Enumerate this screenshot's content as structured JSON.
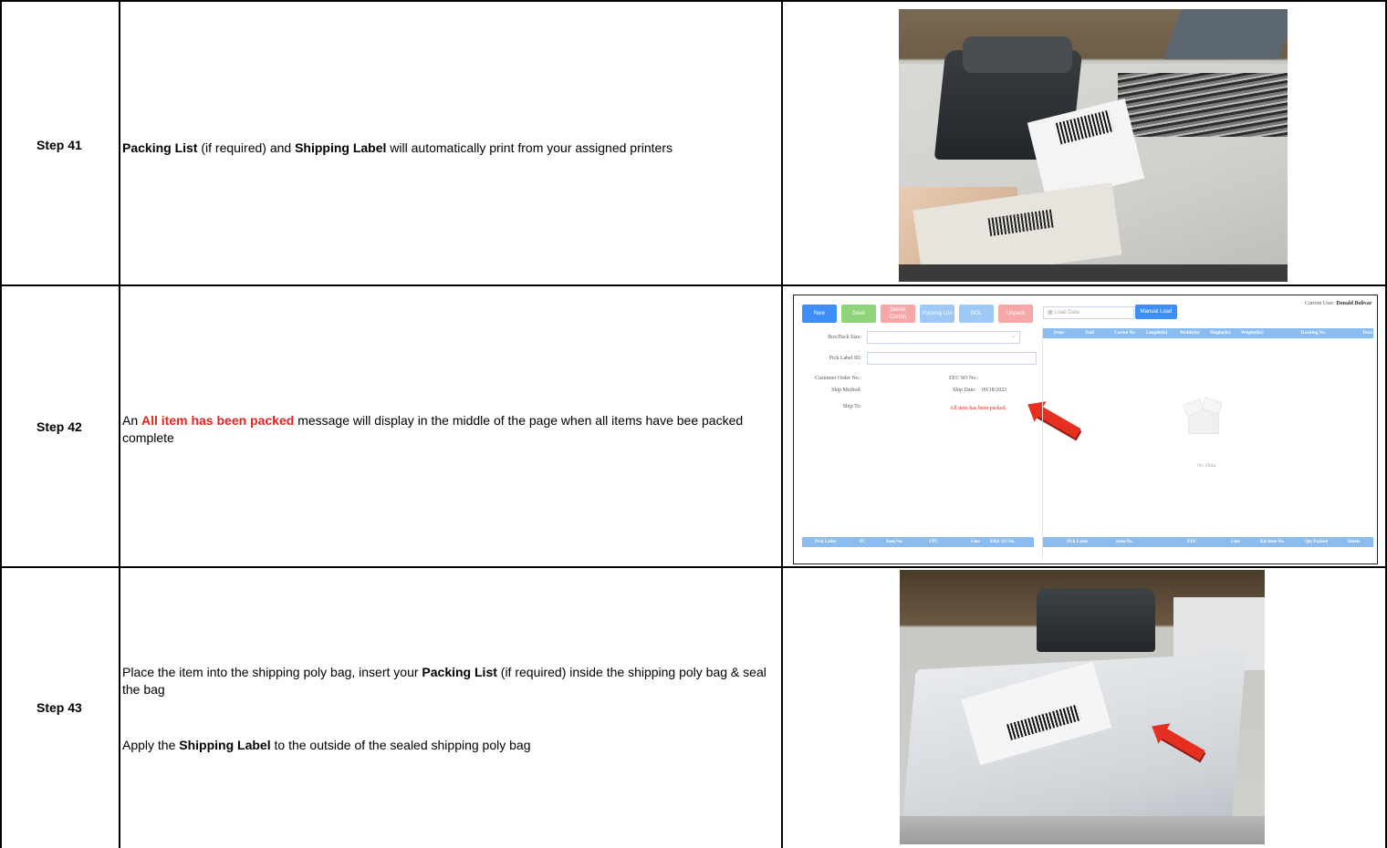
{
  "steps": [
    {
      "label": "Step 41",
      "desc": {
        "b1": "Packing List",
        "t1": " (if required) and ",
        "b2": "Shipping Label",
        "t2": " will automatically print from your assigned printers"
      }
    },
    {
      "label": "Step 42",
      "desc": {
        "t1": "An ",
        "r1": "All item has been packed",
        "t2": " message will display in the middle of the page when all items have bee packed complete"
      }
    },
    {
      "label": "Step 43",
      "desc": {
        "p1a": "Place the item into the shipping poly bag, insert your ",
        "p1b": "Packing List",
        "p1c": " (if required) inside the shipping poly bag & seal the bag",
        "p2a": "Apply the ",
        "p2b": "Shipping Label",
        "p2c": " to the outside of the sealed shipping poly bag"
      }
    }
  ],
  "screenshot": {
    "buttons": {
      "new": "New",
      "save": "Save",
      "delete_line1": "Delete",
      "delete_line2": "Carton",
      "packing_list": "Packing List",
      "bol": "BOL",
      "unpack": "Unpack",
      "manual_load": "Manual Load"
    },
    "load_date_placeholder": "Load Date",
    "current_user_label": "Current User: ",
    "current_user": "Donald Bolivar",
    "fields": {
      "box_pack_size": "Box/Pack Size:",
      "pick_label_id": "Pick Label ID:",
      "customer_order_no": "Customer Order No.:",
      "eec_so_no": "EEC SO No.:",
      "ship_method": "Ship Method:",
      "ship_date_label": "Ship Date:",
      "ship_date": "09/18/2023",
      "ship_to": "Ship To:"
    },
    "packed_message": "All item has been packed.",
    "no_data": "No Data",
    "carton_headers": [
      "Print",
      "Void",
      "Carton No.",
      "Length(In)",
      "Width(In)",
      "Height(In)",
      "Weight(lbs)",
      "Tracking No.",
      "Total"
    ],
    "left_bottom_headers": [
      "Pick Label",
      "PC",
      "Item No.",
      "UPC",
      "Line",
      "E&E SO No."
    ],
    "right_bottom_headers": [
      "Pick Label",
      "Item No.",
      "UPC",
      "Line",
      "Kit Item No.",
      "Qty Packed",
      "Delete"
    ]
  }
}
